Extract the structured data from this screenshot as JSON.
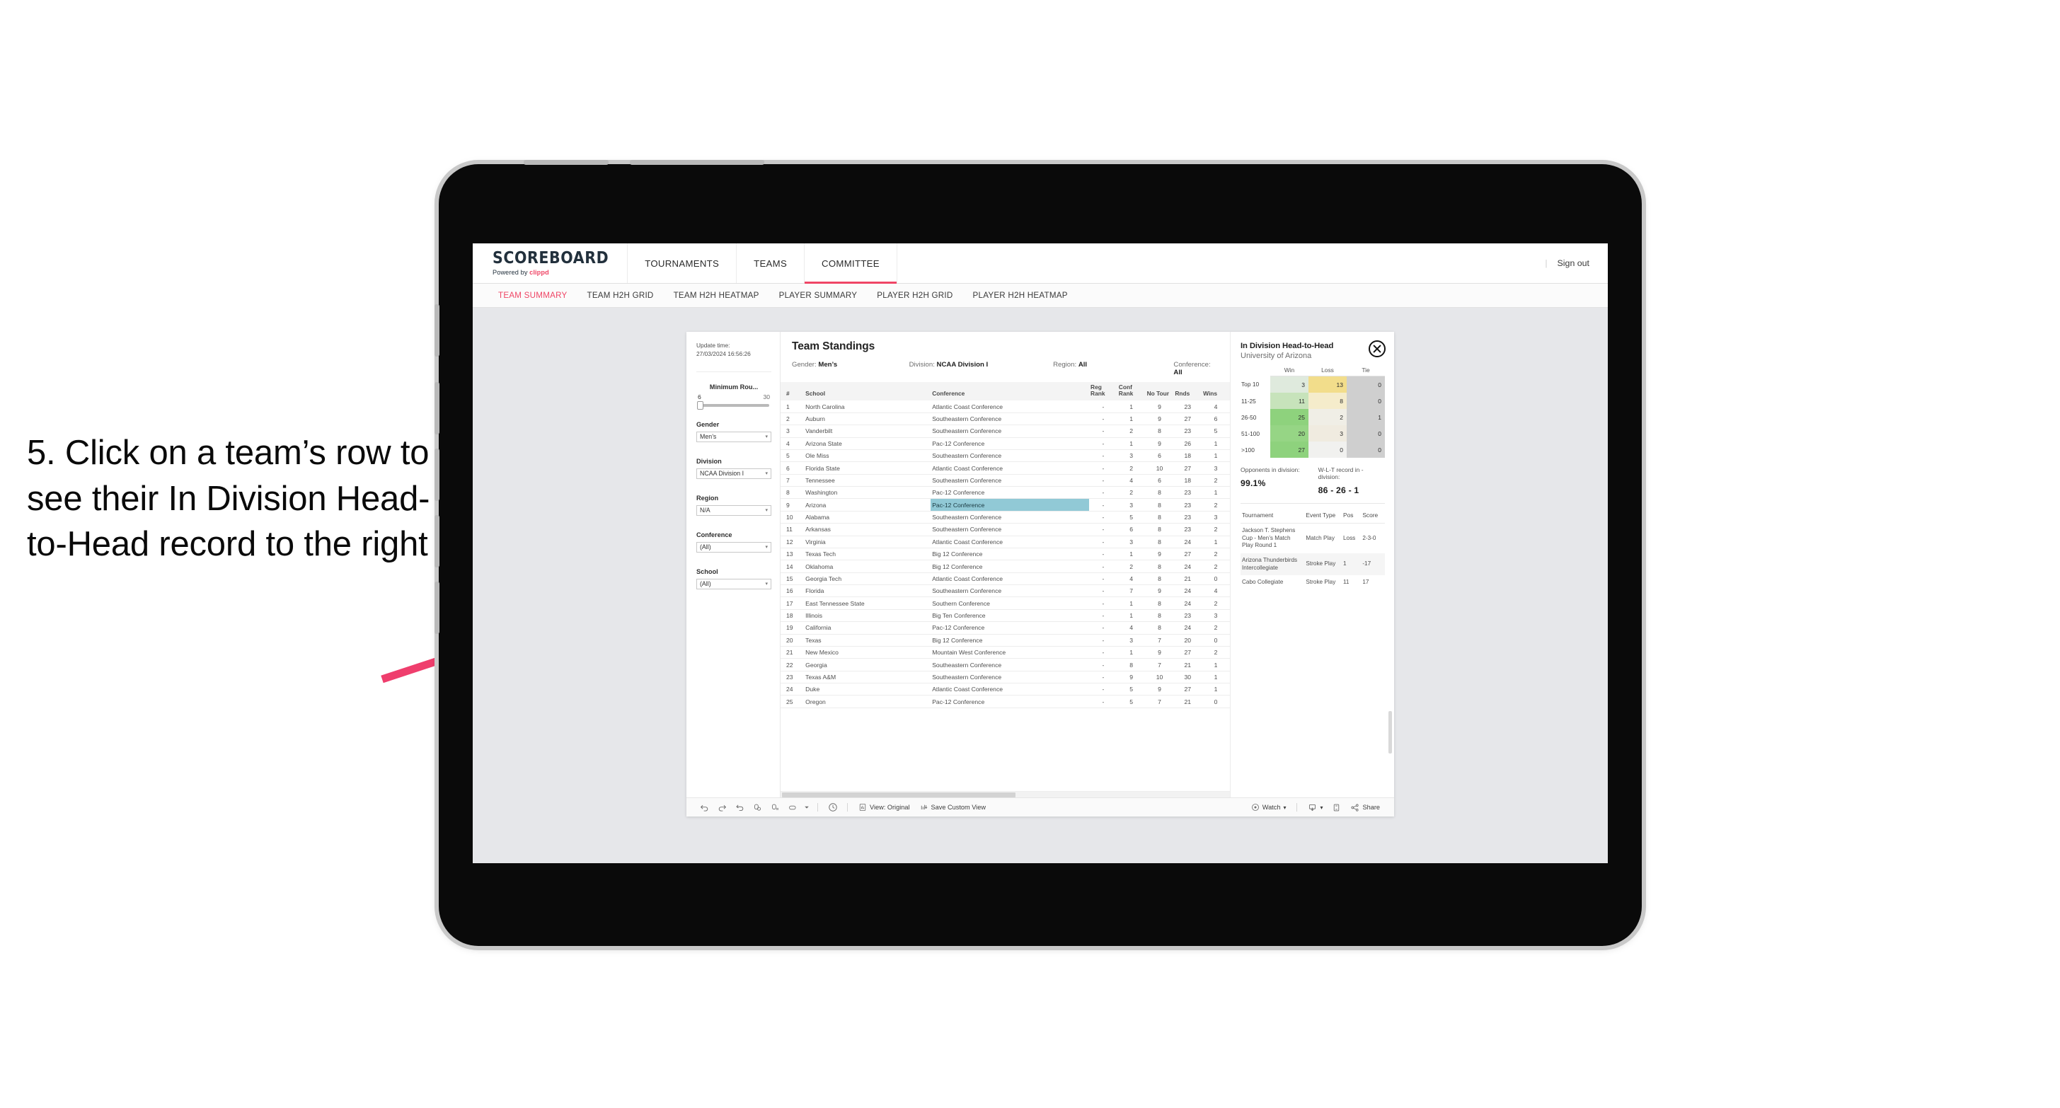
{
  "annotation": {
    "text": "5. Click on a team’s row to see their In Division Head-to-Head record to the right",
    "arrow_color": "#ef3e6d"
  },
  "app": {
    "brand": {
      "title": "SCOREBOARD",
      "powered_prefix": "Powered by ",
      "powered_brand": "clippd"
    },
    "nav": [
      {
        "label": "TOURNAMENTS",
        "active": false
      },
      {
        "label": "TEAMS",
        "active": false
      },
      {
        "label": "COMMITTEE",
        "active": true
      }
    ],
    "topbar_right": {
      "divider": "|",
      "sign_out": "Sign out"
    },
    "subtabs": [
      {
        "label": "TEAM SUMMARY",
        "active": true
      },
      {
        "label": "TEAM H2H GRID",
        "active": false
      },
      {
        "label": "TEAM H2H HEATMAP",
        "active": false
      },
      {
        "label": "PLAYER SUMMARY",
        "active": false
      },
      {
        "label": "PLAYER H2H GRID",
        "active": false
      },
      {
        "label": "PLAYER H2H HEATMAP",
        "active": false
      }
    ],
    "accent_color": "#ef4565"
  },
  "filters": {
    "update_time_label": "Update time:",
    "update_time_value": "27/03/2024 16:56:26",
    "slider": {
      "title": "Minimum Rou...",
      "min": "6",
      "max": "30"
    },
    "groups": [
      {
        "title": "Gender",
        "value": "Men’s"
      },
      {
        "title": "Division",
        "value": "NCAA Division I"
      },
      {
        "title": "Region",
        "value": "N/A"
      },
      {
        "title": "Conference",
        "value": "(All)"
      },
      {
        "title": "School",
        "value": "(All)"
      }
    ]
  },
  "standings": {
    "title": "Team Standings",
    "meta": [
      {
        "label": "Gender:",
        "value": "Men’s"
      },
      {
        "label": "Division:",
        "value": "NCAA Division I"
      },
      {
        "label": "Region:",
        "value": "All"
      },
      {
        "label": "Conference:",
        "value": "All"
      }
    ],
    "columns": [
      "#",
      "School",
      "Conference",
      "Reg Rank",
      "Conf Rank",
      "No Tour",
      "Rnds",
      "Wins"
    ],
    "selected_row_index": 8,
    "selected_highlight_color": "#91c9d6",
    "rows": [
      {
        "rank": "1",
        "school": "North Carolina",
        "conference": "Atlantic Coast Conference",
        "reg_rank": "-",
        "conf_rank": "1",
        "no_tour": "9",
        "rnds": "23",
        "wins": "4"
      },
      {
        "rank": "2",
        "school": "Auburn",
        "conference": "Southeastern Conference",
        "reg_rank": "-",
        "conf_rank": "1",
        "no_tour": "9",
        "rnds": "27",
        "wins": "6"
      },
      {
        "rank": "3",
        "school": "Vanderbilt",
        "conference": "Southeastern Conference",
        "reg_rank": "-",
        "conf_rank": "2",
        "no_tour": "8",
        "rnds": "23",
        "wins": "5"
      },
      {
        "rank": "4",
        "school": "Arizona State",
        "conference": "Pac-12 Conference",
        "reg_rank": "-",
        "conf_rank": "1",
        "no_tour": "9",
        "rnds": "26",
        "wins": "1"
      },
      {
        "rank": "5",
        "school": "Ole Miss",
        "conference": "Southeastern Conference",
        "reg_rank": "-",
        "conf_rank": "3",
        "no_tour": "6",
        "rnds": "18",
        "wins": "1"
      },
      {
        "rank": "6",
        "school": "Florida State",
        "conference": "Atlantic Coast Conference",
        "reg_rank": "-",
        "conf_rank": "2",
        "no_tour": "10",
        "rnds": "27",
        "wins": "3"
      },
      {
        "rank": "7",
        "school": "Tennessee",
        "conference": "Southeastern Conference",
        "reg_rank": "-",
        "conf_rank": "4",
        "no_tour": "6",
        "rnds": "18",
        "wins": "2"
      },
      {
        "rank": "8",
        "school": "Washington",
        "conference": "Pac-12 Conference",
        "reg_rank": "-",
        "conf_rank": "2",
        "no_tour": "8",
        "rnds": "23",
        "wins": "1"
      },
      {
        "rank": "9",
        "school": "Arizona",
        "conference": "Pac-12 Conference",
        "reg_rank": "-",
        "conf_rank": "3",
        "no_tour": "8",
        "rnds": "23",
        "wins": "2"
      },
      {
        "rank": "10",
        "school": "Alabama",
        "conference": "Southeastern Conference",
        "reg_rank": "-",
        "conf_rank": "5",
        "no_tour": "8",
        "rnds": "23",
        "wins": "3"
      },
      {
        "rank": "11",
        "school": "Arkansas",
        "conference": "Southeastern Conference",
        "reg_rank": "-",
        "conf_rank": "6",
        "no_tour": "8",
        "rnds": "23",
        "wins": "2"
      },
      {
        "rank": "12",
        "school": "Virginia",
        "conference": "Atlantic Coast Conference",
        "reg_rank": "-",
        "conf_rank": "3",
        "no_tour": "8",
        "rnds": "24",
        "wins": "1"
      },
      {
        "rank": "13",
        "school": "Texas Tech",
        "conference": "Big 12 Conference",
        "reg_rank": "-",
        "conf_rank": "1",
        "no_tour": "9",
        "rnds": "27",
        "wins": "2"
      },
      {
        "rank": "14",
        "school": "Oklahoma",
        "conference": "Big 12 Conference",
        "reg_rank": "-",
        "conf_rank": "2",
        "no_tour": "8",
        "rnds": "24",
        "wins": "2"
      },
      {
        "rank": "15",
        "school": "Georgia Tech",
        "conference": "Atlantic Coast Conference",
        "reg_rank": "-",
        "conf_rank": "4",
        "no_tour": "8",
        "rnds": "21",
        "wins": "0"
      },
      {
        "rank": "16",
        "school": "Florida",
        "conference": "Southeastern Conference",
        "reg_rank": "-",
        "conf_rank": "7",
        "no_tour": "9",
        "rnds": "24",
        "wins": "4"
      },
      {
        "rank": "17",
        "school": "East Tennessee State",
        "conference": "Southern Conference",
        "reg_rank": "-",
        "conf_rank": "1",
        "no_tour": "8",
        "rnds": "24",
        "wins": "2"
      },
      {
        "rank": "18",
        "school": "Illinois",
        "conference": "Big Ten Conference",
        "reg_rank": "-",
        "conf_rank": "1",
        "no_tour": "8",
        "rnds": "23",
        "wins": "3"
      },
      {
        "rank": "19",
        "school": "California",
        "conference": "Pac-12 Conference",
        "reg_rank": "-",
        "conf_rank": "4",
        "no_tour": "8",
        "rnds": "24",
        "wins": "2"
      },
      {
        "rank": "20",
        "school": "Texas",
        "conference": "Big 12 Conference",
        "reg_rank": "-",
        "conf_rank": "3",
        "no_tour": "7",
        "rnds": "20",
        "wins": "0"
      },
      {
        "rank": "21",
        "school": "New Mexico",
        "conference": "Mountain West Conference",
        "reg_rank": "-",
        "conf_rank": "1",
        "no_tour": "9",
        "rnds": "27",
        "wins": "2"
      },
      {
        "rank": "22",
        "school": "Georgia",
        "conference": "Southeastern Conference",
        "reg_rank": "-",
        "conf_rank": "8",
        "no_tour": "7",
        "rnds": "21",
        "wins": "1"
      },
      {
        "rank": "23",
        "school": "Texas A&M",
        "conference": "Southeastern Conference",
        "reg_rank": "-",
        "conf_rank": "9",
        "no_tour": "10",
        "rnds": "30",
        "wins": "1"
      },
      {
        "rank": "24",
        "school": "Duke",
        "conference": "Atlantic Coast Conference",
        "reg_rank": "-",
        "conf_rank": "5",
        "no_tour": "9",
        "rnds": "27",
        "wins": "1"
      },
      {
        "rank": "25",
        "school": "Oregon",
        "conference": "Pac-12 Conference",
        "reg_rank": "-",
        "conf_rank": "5",
        "no_tour": "7",
        "rnds": "21",
        "wins": "0"
      }
    ]
  },
  "h2h": {
    "title": "In Division Head-to-Head",
    "subtitle": "University of Arizona",
    "close_icon": "close-icon",
    "chart_data": {
      "type": "heatmap",
      "title": "In Division Head-to-Head",
      "subtitle": "University of Arizona",
      "columns": [
        "Win",
        "Loss",
        "Tie"
      ],
      "rows": [
        "Top 10",
        "11-25",
        "26-50",
        "51-100",
        ">100"
      ],
      "values": [
        [
          3,
          13,
          0
        ],
        [
          11,
          8,
          0
        ],
        [
          25,
          2,
          1
        ],
        [
          20,
          3,
          0
        ],
        [
          27,
          0,
          0
        ]
      ],
      "cell_colors": [
        [
          "#dfeadd",
          "#f2dd8b",
          "#cfcfcf"
        ],
        [
          "#c7e3bb",
          "#f5eccb",
          "#cfcfcf"
        ],
        [
          "#8ed27d",
          "#f0eee6",
          "#cfcfcf"
        ],
        [
          "#96d585",
          "#f0ebe0",
          "#cfcfcf"
        ],
        [
          "#8ed27d",
          "#f1f1ef",
          "#cfcfcf"
        ]
      ],
      "legend_position": "top"
    },
    "stats": [
      {
        "label": "Opponents in division:",
        "value": "99.1%"
      },
      {
        "label": "W-L-T record in -division:",
        "value": "86 - 26 - 1"
      }
    ],
    "tournaments": {
      "columns": [
        "Tournament",
        "Event Type",
        "Pos",
        "Score"
      ],
      "rows": [
        {
          "name": "Jackson T. Stephens Cup - Men’s Match Play Round 1",
          "type": "Match Play",
          "pos": "Loss",
          "score": "2-3-0"
        },
        {
          "name": "Arizona Thunderbirds Intercollegiate",
          "type": "Stroke Play",
          "pos": "1",
          "score": "-17"
        },
        {
          "name": "Cabo Collegiate",
          "type": "Stroke Play",
          "pos": "11",
          "score": "17"
        }
      ]
    }
  },
  "toolbar": {
    "icons": [
      "undo-icon",
      "redo-icon",
      "revert-icon",
      "refresh-data-icon",
      "pause-icon",
      "device-layout-icon",
      "chevron-down-icon"
    ],
    "clock_icon": "clock-icon",
    "view_label": "View: Original",
    "view_icon": "view-original-icon",
    "save_label": "Save Custom View",
    "save_icon": "save-view-icon",
    "watch_label": "Watch",
    "watch_icon": "watch-icon",
    "watch_caret": "▾",
    "download_icon": "download-icon",
    "download_caret": "▾",
    "fullscreen_icon": "fullscreen-icon",
    "share_label": "Share",
    "share_icon": "share-icon"
  }
}
